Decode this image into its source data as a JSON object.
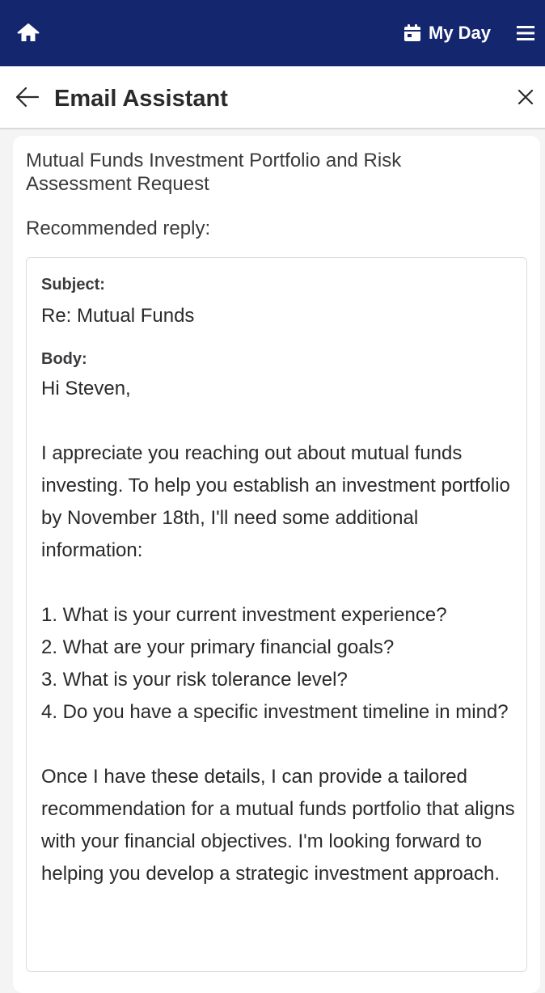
{
  "topbar": {
    "my_day_label": "My Day"
  },
  "header": {
    "title": "Email Assistant"
  },
  "email": {
    "subject_line": "Mutual Funds Investment Portfolio and Risk Assessment Request",
    "recommended_label": "Recommended reply:"
  },
  "reply": {
    "subject_label": "Subject:",
    "subject_value": "Re: Mutual Funds",
    "body_label": "Body:",
    "greeting": "Hi Steven,",
    "paragraph1": "I appreciate you reaching out about mutual funds investing. To help you establish an investment portfolio by November 18th, I'll need some additional information:",
    "questions": [
      "1. What is your current investment experience?",
      "2. What are your primary financial goals?",
      "3. What is your risk tolerance level?",
      "4. Do you have a specific investment timeline in mind?"
    ],
    "paragraph2": "Once I have these details, I can provide a tailored recommendation for a mutual funds portfolio that aligns with your financial objectives. I'm looking forward to helping you develop a strategic investment approach."
  },
  "colors": {
    "topbar_bg": "#14266e",
    "page_bg": "#f4f4f5"
  }
}
